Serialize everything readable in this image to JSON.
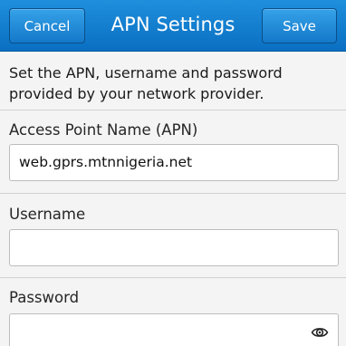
{
  "header": {
    "title": "APN Settings",
    "cancel_label": "Cancel",
    "save_label": "Save"
  },
  "description": "Set the APN, username and password provided by your network provider.",
  "fields": {
    "apn": {
      "label": "Access Point Name (APN)",
      "value": "web.gprs.mtnnigeria.net"
    },
    "username": {
      "label": "Username",
      "value": ""
    },
    "password": {
      "label": "Password",
      "value": "",
      "toggle_icon": "eye-icon"
    }
  },
  "colors": {
    "header": "#1380d2",
    "background": "#f4f4f4",
    "field": "#ffffff"
  }
}
